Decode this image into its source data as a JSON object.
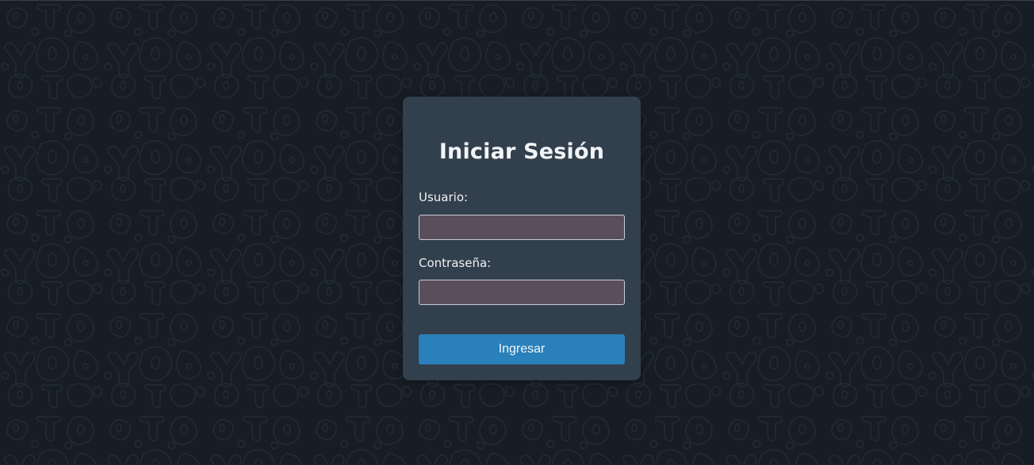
{
  "colors": {
    "background": "#171d24",
    "pattern_stroke": "#222c35",
    "card": "#323f4c",
    "input_fill": "#5a4e5c",
    "input_border": "#c9ccd2",
    "button": "#2a80ba",
    "text": "#f2f4f7"
  },
  "login": {
    "title": "Iniciar Sesión",
    "username_label": "Usuario:",
    "username_value": "",
    "password_label": "Contraseña:",
    "password_value": "",
    "submit_label": "Ingresar"
  }
}
